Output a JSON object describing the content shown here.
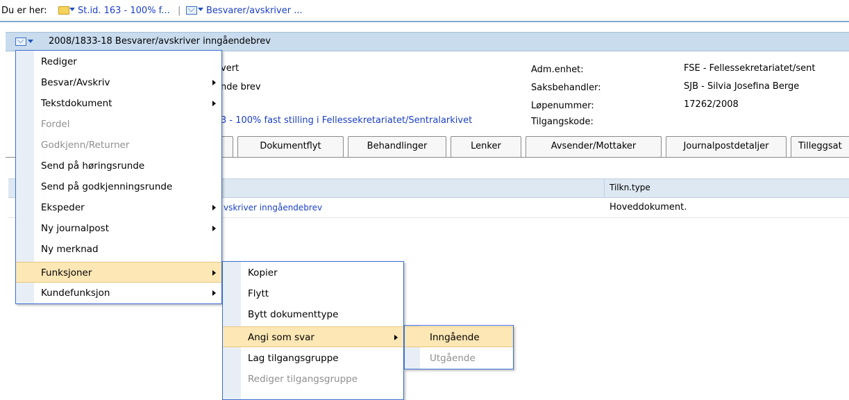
{
  "breadcrumb": {
    "prefix": "Du er her:",
    "item1": "St.id. 163 - 100% f...",
    "separator": "|",
    "item2": "Besvarer/avskriver ..."
  },
  "header": {
    "title": "2008/1833-18  Besvarer/avskriver inngåendebrev"
  },
  "details": {
    "left_line1": "vert",
    "left_line2": "nde brev",
    "case_link": "3 - 100% fast stilling i Fellessekretariatet/Sentralarkivet",
    "fields": [
      {
        "label": "Adm.enhet:",
        "value": "FSE - Fellessekretariatet/sent"
      },
      {
        "label": "Saksbehandler:",
        "value": "SJB - Silvia Josefina Berge"
      },
      {
        "label": "Løpenummer:",
        "value": "17262/2008"
      },
      {
        "label": "Tilgangskode:",
        "value": ""
      }
    ]
  },
  "tabs": [
    "Dokumentflyt",
    "Behandlinger",
    "Lenker",
    "Avsender/Mottaker",
    "Journalpostdetaljer",
    "Tilleggsat"
  ],
  "grid": {
    "col_tilkn": "Tilkn.type",
    "row1_doc": "vskriver inngåendebrev",
    "row1_type": "Hoveddokument."
  },
  "menu1": {
    "items": [
      {
        "label": "Rediger",
        "disabled": false,
        "submenu": false
      },
      {
        "label": "Besvar/Avskriv",
        "disabled": false,
        "submenu": true
      },
      {
        "label": "Tekstdokument",
        "disabled": false,
        "submenu": true
      },
      {
        "label": "Fordel",
        "disabled": true,
        "submenu": false
      },
      {
        "label": "Godkjenn/Returner",
        "disabled": true,
        "submenu": false
      },
      {
        "label": "Send på høringsrunde",
        "disabled": false,
        "submenu": false
      },
      {
        "label": "Send på godkjenningsrunde",
        "disabled": false,
        "submenu": false
      },
      {
        "label": "Ekspeder",
        "disabled": false,
        "submenu": true
      },
      {
        "label": "Ny journalpost",
        "disabled": false,
        "submenu": true
      },
      {
        "label": "Ny merknad",
        "disabled": false,
        "submenu": false
      },
      {
        "label": "Funksjoner",
        "disabled": false,
        "submenu": true,
        "highlighted": true
      },
      {
        "label": "Kundefunksjon",
        "disabled": false,
        "submenu": true
      }
    ]
  },
  "menu2": {
    "items": [
      {
        "label": "Kopier",
        "disabled": false,
        "submenu": false
      },
      {
        "label": "Flytt",
        "disabled": false,
        "submenu": false
      },
      {
        "label": "Bytt dokumenttype",
        "disabled": false,
        "submenu": false
      },
      {
        "label": "Angi som svar",
        "disabled": false,
        "submenu": true,
        "highlighted": true
      },
      {
        "label": "Lag tilgangsgruppe",
        "disabled": false,
        "submenu": false
      },
      {
        "label": "Rediger tilgangsgruppe",
        "disabled": true,
        "submenu": false
      }
    ]
  },
  "menu3": {
    "items": [
      {
        "label": "Inngående",
        "disabled": false,
        "highlighted": true
      },
      {
        "label": "Utgående",
        "disabled": true
      }
    ]
  },
  "colors": {
    "accent_border": "#3a6fd0",
    "highlight": "#fde7b5",
    "link": "#1a3fc7",
    "header_bar": "#c9dcee"
  }
}
